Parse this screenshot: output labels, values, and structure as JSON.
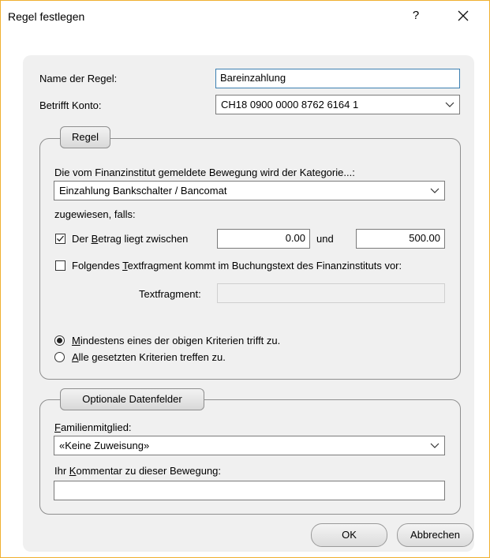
{
  "window": {
    "title": "Regel festlegen",
    "help_label": "?"
  },
  "fields": {
    "rule_name_label": "Name der Regel:",
    "rule_name_value": "Bareinzahlung",
    "account_label": "Betrifft Konto:",
    "account_value": "CH18 0900 0000 8762 6164 1"
  },
  "rule_group": {
    "title": "Regel",
    "category_prompt": "Die vom Finanzinstitut gemeldete Bewegung wird der Kategorie...:",
    "category_value": "Einzahlung Bankschalter / Bancomat",
    "assigned_if": "zugewiesen, falls:",
    "amount_check": {
      "checked": true,
      "label_pre": "Der ",
      "label_u": "B",
      "label_post": "etrag liegt zwischen",
      "from": "0.00",
      "and": "und",
      "to": "500.00"
    },
    "text_check": {
      "checked": false,
      "label_pre": "Folgendes ",
      "label_u": "T",
      "label_post": "extfragment kommt im Buchungstext des Finanzinstituts vor:"
    },
    "text_fragment_label": "Textfragment:",
    "text_fragment_value": "",
    "radio_any": {
      "selected": true,
      "label_u": "M",
      "label_post": "indestens eines der obigen Kriterien trifft zu."
    },
    "radio_all": {
      "selected": false,
      "label_u": "A",
      "label_post": "lle gesetzten Kriterien treffen zu."
    }
  },
  "optional_group": {
    "title": "Optionale Datenfelder",
    "family_label_u": "F",
    "family_label_post": "amilienmitglied:",
    "family_value": "«Keine Zuweisung»",
    "comment_label_pre": "Ihr ",
    "comment_label_u": "K",
    "comment_label_post": "ommentar zu dieser Bewegung:",
    "comment_value": ""
  },
  "buttons": {
    "ok": "OK",
    "cancel": "Abbrechen"
  },
  "colors": {
    "focus_border": "#3c7fb1",
    "window_border": "#f0b030"
  }
}
